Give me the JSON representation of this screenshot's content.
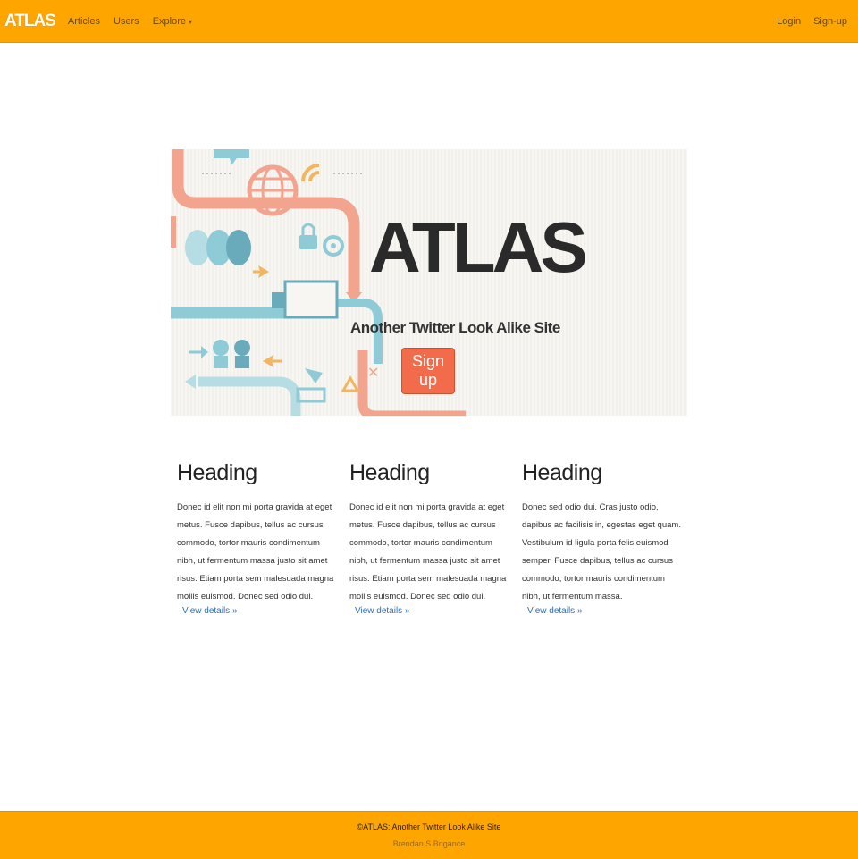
{
  "navbar": {
    "brand": "ATLAS",
    "links": [
      "Articles",
      "Users",
      "Explore"
    ],
    "right_links": [
      "Login",
      "Sign-up"
    ],
    "accent_color": "#ffa500"
  },
  "hero": {
    "title": "ATLAS",
    "subtitle": "Another Twitter Look Alike Site",
    "button_label": "Sign up",
    "button_color": "#f26b4a"
  },
  "columns": [
    {
      "heading": "Heading",
      "text": "Donec id elit non mi porta gravida at eget metus. Fusce dapibus, tellus ac cursus commodo, tortor mauris condimentum nibh, ut fermentum massa justo sit amet risus. Etiam porta sem malesuada magna mollis euismod. Donec sed odio dui.",
      "link": "View details »"
    },
    {
      "heading": "Heading",
      "text": "Donec id elit non mi porta gravida at eget metus. Fusce dapibus, tellus ac cursus commodo, tortor mauris condimentum nibh, ut fermentum massa justo sit amet risus. Etiam porta sem malesuada magna mollis euismod. Donec sed odio dui.",
      "link": "View details »"
    },
    {
      "heading": "Heading",
      "text": "Donec sed odio dui. Cras justo odio, dapibus ac facilisis in, egestas eget quam. Vestibulum id ligula porta felis euismod semper. Fusce dapibus, tellus ac cursus commodo, tortor mauris condimentum nibh, ut fermentum massa.",
      "link": "View details »"
    }
  ],
  "footer": {
    "line1": "©ATLAS: Another Twitter Look Alike Site",
    "line2": "Brendan S Brigance"
  }
}
